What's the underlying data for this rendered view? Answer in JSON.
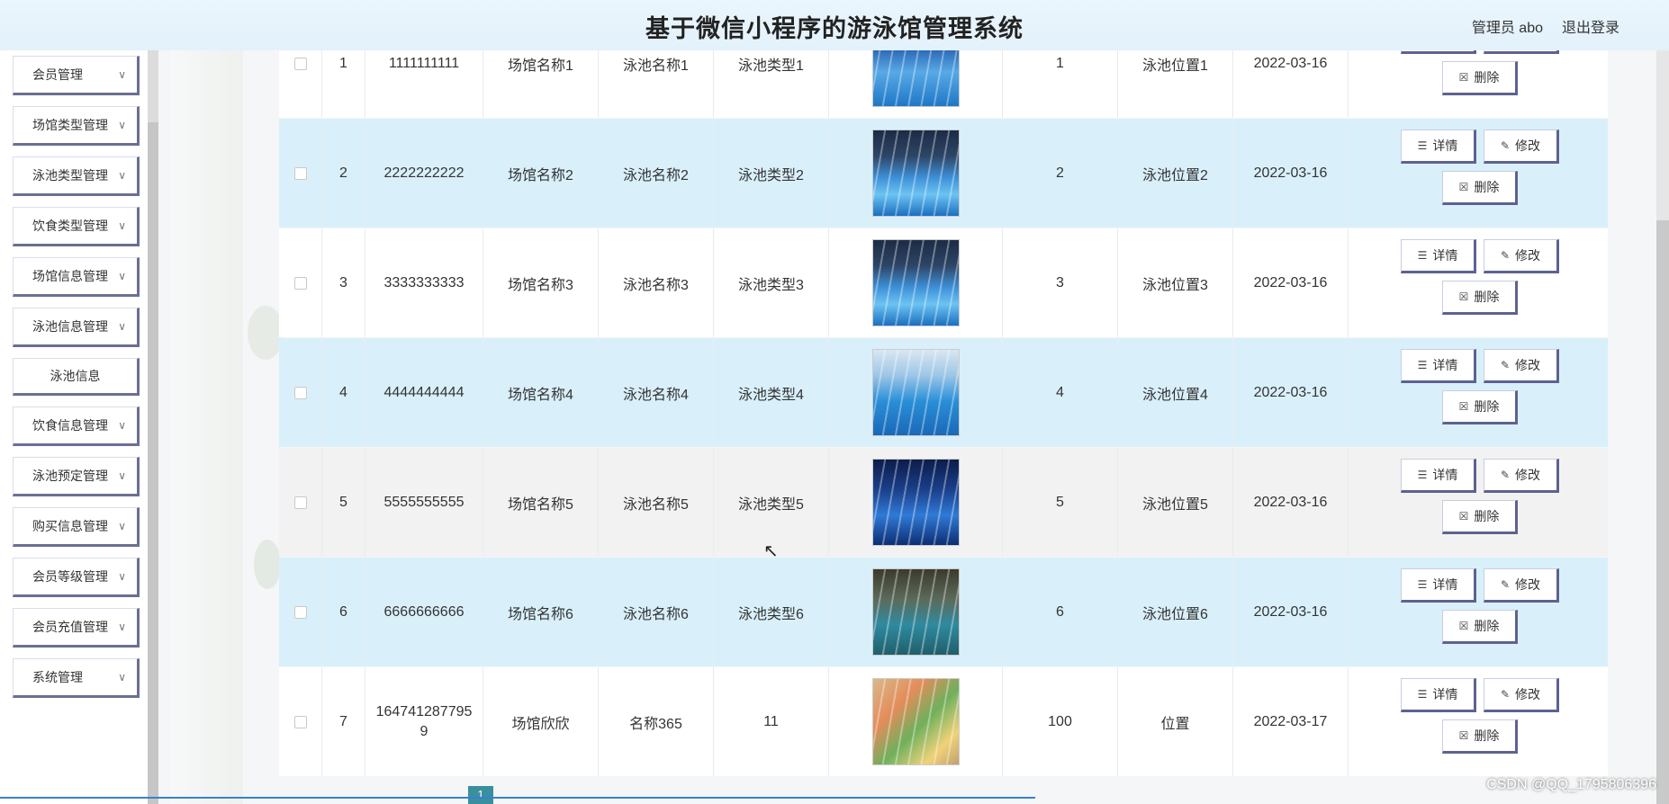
{
  "header": {
    "title": "基于微信小程序的游泳馆管理系统",
    "user": "管理员 abo",
    "logout": "退出登录"
  },
  "sidebar": {
    "items": [
      {
        "label": "会员管理",
        "type": "group"
      },
      {
        "label": "场馆类型管理",
        "type": "group"
      },
      {
        "label": "泳池类型管理",
        "type": "group"
      },
      {
        "label": "饮食类型管理",
        "type": "group"
      },
      {
        "label": "场馆信息管理",
        "type": "group"
      },
      {
        "label": "泳池信息管理",
        "type": "group"
      },
      {
        "label": "泳池信息",
        "type": "subitem"
      },
      {
        "label": "饮食信息管理",
        "type": "group"
      },
      {
        "label": "泳池预定管理",
        "type": "group"
      },
      {
        "label": "购买信息管理",
        "type": "group"
      },
      {
        "label": "会员等级管理",
        "type": "group"
      },
      {
        "label": "会员充值管理",
        "type": "group"
      },
      {
        "label": "系统管理",
        "type": "group"
      }
    ]
  },
  "table": {
    "rows": [
      {
        "idx": "1",
        "acct": "1111111111",
        "venue": "场馆名称1",
        "pool": "泳池名称1",
        "type": "泳池类型1",
        "img": "pool-a",
        "num": "1",
        "pos": "泳池位置1",
        "date": "2022-03-16"
      },
      {
        "idx": "2",
        "acct": "2222222222",
        "venue": "场馆名称2",
        "pool": "泳池名称2",
        "type": "泳池类型2",
        "img": "pool-b",
        "num": "2",
        "pos": "泳池位置2",
        "date": "2022-03-16"
      },
      {
        "idx": "3",
        "acct": "3333333333",
        "venue": "场馆名称3",
        "pool": "泳池名称3",
        "type": "泳池类型3",
        "img": "pool-b",
        "num": "3",
        "pos": "泳池位置3",
        "date": "2022-03-16"
      },
      {
        "idx": "4",
        "acct": "4444444444",
        "venue": "场馆名称4",
        "pool": "泳池名称4",
        "type": "泳池类型4",
        "img": "pool-c",
        "num": "4",
        "pos": "泳池位置4",
        "date": "2022-03-16"
      },
      {
        "idx": "5",
        "acct": "5555555555",
        "venue": "场馆名称5",
        "pool": "泳池名称5",
        "type": "泳池类型5",
        "img": "pool-d",
        "num": "5",
        "pos": "泳池位置5",
        "date": "2022-03-16"
      },
      {
        "idx": "6",
        "acct": "6666666666",
        "venue": "场馆名称6",
        "pool": "泳池名称6",
        "type": "泳池类型6",
        "img": "pool-e",
        "num": "6",
        "pos": "泳池位置6",
        "date": "2022-03-16"
      },
      {
        "idx": "7",
        "acct": "1647412877959",
        "venue": "场馆欣欣",
        "pool": "名称365",
        "type": "11",
        "img": "pool-f",
        "num": "100",
        "pos": "位置",
        "date": "2022-03-17"
      }
    ],
    "actions": {
      "detail": "详情",
      "edit": "修改",
      "delete": "删除"
    }
  },
  "pagination": {
    "current_page": "1"
  },
  "watermark": "CSDN @QQ_1795806396",
  "colors": {
    "header_bg": "#e3f1fb",
    "row_alt": "#d9f0fb",
    "button_border": "#5d6291",
    "page_active": "#3a8f9e",
    "progress_line": "#3c7fd1"
  }
}
